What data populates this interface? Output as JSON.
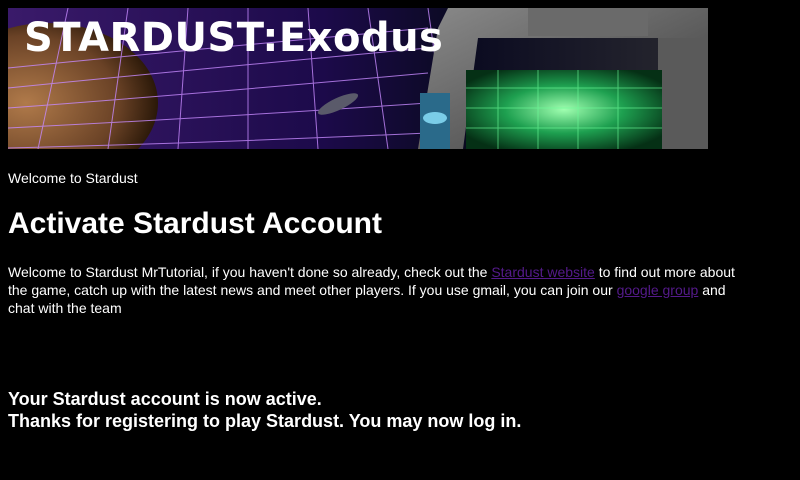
{
  "banner": {
    "title": "STARDUST:Exodus"
  },
  "welcome_line": "Welcome to Stardust",
  "page_title": "Activate Stardust Account",
  "intro": {
    "text_before_link1": "Welcome to Stardust MrTutorial, if you haven't done so already, check out the ",
    "link1": "Stardust website",
    "text_between": " to find out more about the game, catch up with the latest news and meet other players. If you use gmail, you can join our ",
    "link2": "google group",
    "text_after": " and chat with the team"
  },
  "status": {
    "line1": "Your Stardust account is now active.",
    "line2": "Thanks for registering to play Stardust. You may now log in."
  },
  "colors": {
    "background": "#000000",
    "text": "#ffffff",
    "visited_link": "#551a8b"
  }
}
